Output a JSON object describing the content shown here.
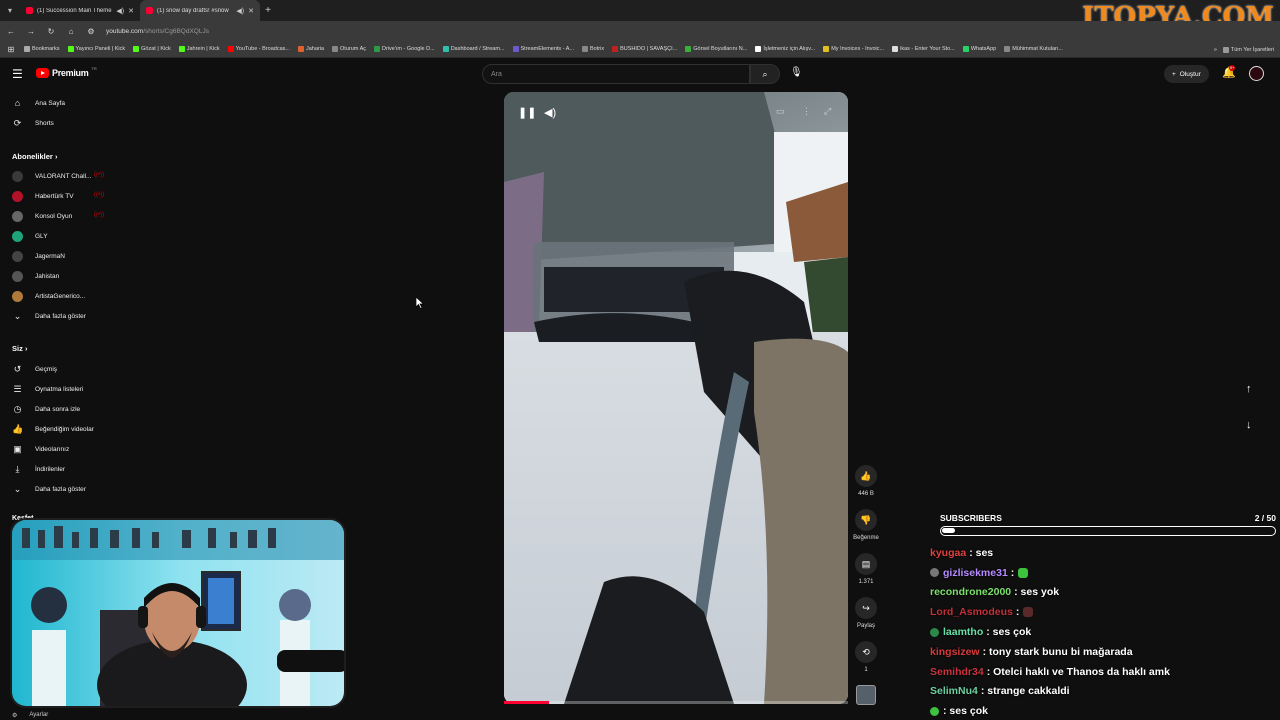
{
  "browser": {
    "tabs": [
      {
        "title": "(1) Succession Main Theme",
        "active": false
      },
      {
        "title": "(1) snow day drafts! #snow",
        "active": true
      }
    ],
    "url_host": "youtube.com",
    "url_path": "/shorts/Cg6BQdXQLJs",
    "bookmarks": [
      "Bookmarks",
      "Yayıncı Paneli | Kick",
      "Gözat | Kick",
      "Jahrein | Kick",
      "YouTube - Broadcas...",
      "Jaharia",
      "Oturum Aç",
      "Drive'ım - Google D...",
      "Dashboard / Stream...",
      "StreamElements - A...",
      "Botrix",
      "BUSHIDO | SAVAŞÇI...",
      "Görsel Boyutlarını N...",
      "İşletmeniz için Alışv...",
      "My Invoices - Invoic...",
      "ikas - Enter Your Sto...",
      "WhatsApp",
      "Mühimmat Kutuları..."
    ],
    "bookmarks_more": "»",
    "all_bookmarks": "Tüm Yer İşaretleri",
    "watermark": "ITOPYA.COM"
  },
  "header": {
    "brand": "Premium",
    "tm": "TR",
    "search_placeholder": "Ara",
    "create_label": "Oluştur",
    "notification_count": "9+"
  },
  "sidebar": {
    "main": [
      {
        "label": "Ana Sayfa",
        "icon": "home-icon"
      },
      {
        "label": "Shorts",
        "icon": "shorts-icon"
      }
    ],
    "subscriptions_title": "Abonelikler",
    "subscriptions": [
      {
        "label": "VALORANT Chall...",
        "live": true,
        "color": "#3a3a3a"
      },
      {
        "label": "Habertürk TV",
        "live": true,
        "color": "#b3122b"
      },
      {
        "label": "Konsol Oyun",
        "live": true,
        "color": "#666"
      },
      {
        "label": "GLY",
        "live": false,
        "color": "#1ea37a"
      },
      {
        "label": "JagermaN",
        "live": false,
        "color": "#444"
      },
      {
        "label": "Jahistan",
        "live": false,
        "color": "#555"
      },
      {
        "label": "ArtistaGenerico...",
        "live": false,
        "color": "#b07a3a"
      }
    ],
    "show_more": "Daha fazla göster",
    "you_title": "Siz",
    "you": [
      {
        "label": "Geçmiş",
        "icon": "history-icon"
      },
      {
        "label": "Oynatma listeleri",
        "icon": "playlist-icon"
      },
      {
        "label": "Daha sonra izle",
        "icon": "clock-icon"
      },
      {
        "label": "Beğendiğim videolar",
        "icon": "like-icon"
      },
      {
        "label": "Videolarınız",
        "icon": "video-icon"
      },
      {
        "label": "İndirilenler",
        "icon": "download-icon"
      }
    ],
    "show_more_2": "Daha fazla göster",
    "explore_title": "Keşfet",
    "settings": "Ayarlar"
  },
  "actions": {
    "likes": "446 B",
    "dislike_label": "Beğenme",
    "comments": "1.371",
    "share_label": "Paylaş",
    "remix_count": "1"
  },
  "video": {
    "progress": 0.13
  },
  "subscriber_goal": {
    "title": "SUBSCRIBERS",
    "count": "2 / 50",
    "current": 2,
    "target": 50
  },
  "chat": [
    {
      "user": "kyugaa",
      "color": "#e0413e",
      "text": ": ses",
      "badge": null,
      "emote": null
    },
    {
      "user": "gizlisekme31",
      "color": "#b58bff",
      "text": " :",
      "badge": "#777",
      "emote": "#3cc23c"
    },
    {
      "user": "recondrone2000",
      "color": "#7be06a",
      "text": " : ses yok",
      "badge": null,
      "emote": null
    },
    {
      "user": "Lord_Asmodeus",
      "color": "#c3303a",
      "text": " :",
      "badge": null,
      "emote": "#5a2a2a"
    },
    {
      "user": "laamtho",
      "color": "#68e0a8",
      "text": " : ses çok",
      "badge": "#2a8a4a",
      "emote": null
    },
    {
      "user": "kingsizew",
      "color": "#d83a3a",
      "text": " : tony stark bunu bi mağarada",
      "badge": null,
      "emote": null
    },
    {
      "user": "Semihdr34",
      "color": "#c9343e",
      "text": " : Otelci haklı ve Thanos da haklı amk",
      "badge": null,
      "emote": null
    },
    {
      "user": "SelimNu4",
      "color": "#6fd0a0",
      "text": " : strange cakkaldi",
      "badge": null,
      "emote": null
    },
    {
      "user": "",
      "color": "#fff",
      "text": ": ses çok",
      "badge": "#3cc23c",
      "emote": null
    }
  ]
}
